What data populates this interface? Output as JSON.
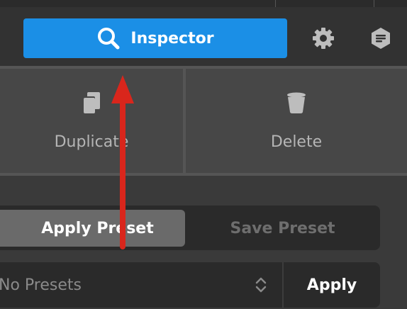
{
  "toolbar": {
    "inspector_label": "Inspector",
    "inspector_icon": "search-icon",
    "settings_icon": "gear-icon",
    "extra_icon": "hexagon-menu-icon",
    "accent": "#1b8fe6"
  },
  "actions": {
    "duplicate_label": "Duplicate",
    "duplicate_icon": "duplicate-icon",
    "delete_label": "Delete",
    "delete_icon": "trash-icon"
  },
  "presets": {
    "tabs": [
      {
        "label": "Apply Preset",
        "selected": true
      },
      {
        "label": "Save Preset",
        "selected": false
      }
    ],
    "select_value": "No Presets",
    "select_icon": "chevron-updown-icon",
    "apply_label": "Apply"
  },
  "annotation": {
    "arrow_color": "#d9261c",
    "arrow_icon": "red-arrow-up"
  }
}
